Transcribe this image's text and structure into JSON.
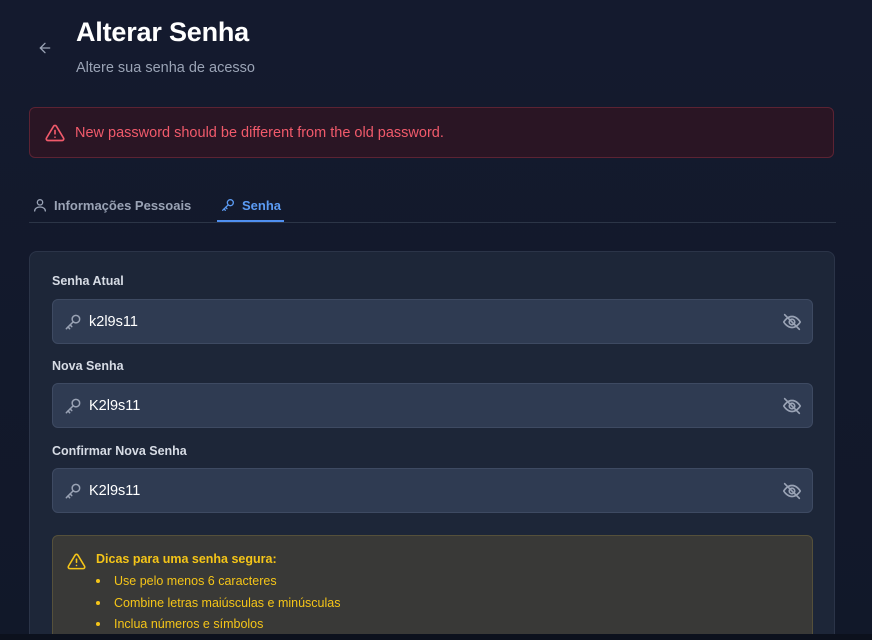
{
  "header": {
    "back_icon": "arrow-left-icon",
    "title": "Alterar Senha",
    "subtitle": "Altere sua senha de acesso"
  },
  "alert": {
    "icon": "warning-triangle-icon",
    "message": "New password should be different from the old password.",
    "color": "#f15a6b"
  },
  "tabs": [
    {
      "label": "Informações Pessoais",
      "icon": "user-icon",
      "active": false
    },
    {
      "label": "Senha",
      "icon": "key-icon",
      "active": true
    }
  ],
  "form": {
    "current_password": {
      "label": "Senha Atual",
      "value": "k2l9s11",
      "icon": "key-icon",
      "toggle_icon": "eye-off-icon"
    },
    "new_password": {
      "label": "Nova Senha",
      "value": "K2l9s11",
      "icon": "key-icon",
      "toggle_icon": "eye-off-icon"
    },
    "confirm_password": {
      "label": "Confirmar Nova Senha",
      "value": "K2l9s11",
      "icon": "key-icon",
      "toggle_icon": "eye-off-icon"
    }
  },
  "tips": {
    "icon": "warning-triangle-icon",
    "title": "Dicas para uma senha segura:",
    "items": [
      "Use pelo menos 6 caracteres",
      "Combine letras maiúsculas e minúsculas",
      "Inclua números e símbolos"
    ],
    "color": "#f5c518"
  },
  "colors": {
    "background": "#141a2c",
    "accent": "#4f8ff0",
    "input_bg": "#2f3b52"
  }
}
